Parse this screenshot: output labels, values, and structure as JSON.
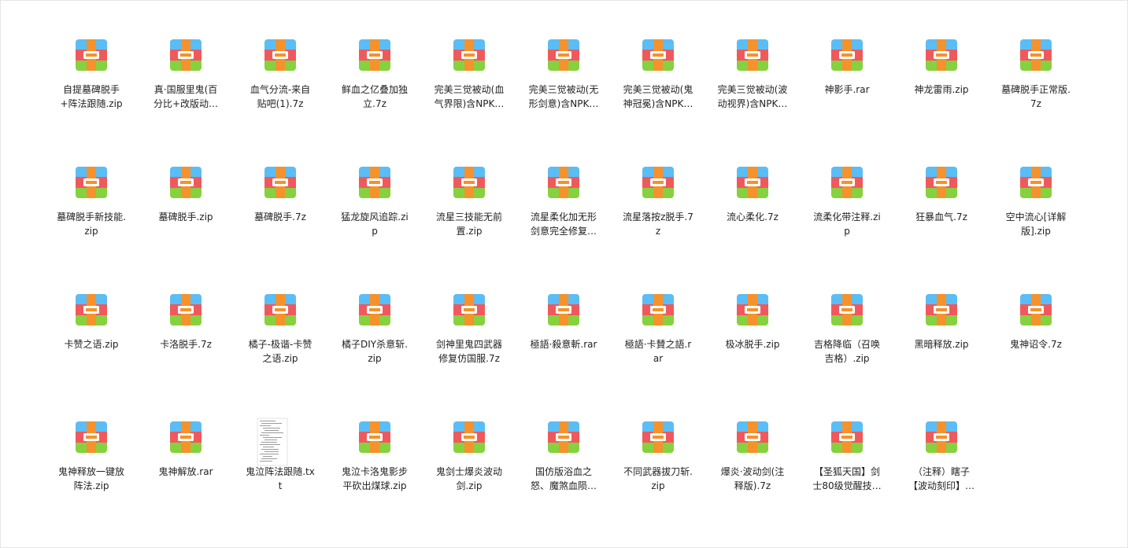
{
  "files": [
    {
      "kind": "archive",
      "lines": [
        "自提墓碑脱手",
        "+阵法跟随.zip"
      ]
    },
    {
      "kind": "archive",
      "lines": [
        "真·国服里鬼(百",
        "分比+改版动…"
      ]
    },
    {
      "kind": "archive",
      "lines": [
        "血气分流-来自",
        "贴吧(1).7z"
      ]
    },
    {
      "kind": "archive",
      "lines": [
        "鲜血之亿叠加独",
        "立.7z"
      ]
    },
    {
      "kind": "archive",
      "lines": [
        "完美三觉被动(血",
        "气界限)含NPK…"
      ]
    },
    {
      "kind": "archive",
      "lines": [
        "完美三觉被动(无",
        "形剑意)含NPK…"
      ]
    },
    {
      "kind": "archive",
      "lines": [
        "完美三觉被动(鬼",
        "神冠冕)含NPK…"
      ]
    },
    {
      "kind": "archive",
      "lines": [
        "完美三觉被动(波",
        "动视界)含NPK…"
      ]
    },
    {
      "kind": "archive",
      "lines": [
        "神影手.rar"
      ]
    },
    {
      "kind": "archive",
      "lines": [
        "神龙雷雨.zip"
      ]
    },
    {
      "kind": "archive",
      "lines": [
        "墓碑脱手正常版.",
        "7z"
      ]
    },
    {
      "kind": "archive",
      "lines": [
        "墓碑脱手新技能.",
        "zip"
      ]
    },
    {
      "kind": "archive",
      "lines": [
        "墓碑脱手.zip"
      ]
    },
    {
      "kind": "archive",
      "lines": [
        "墓碑脱手.7z"
      ]
    },
    {
      "kind": "archive",
      "lines": [
        "猛龙旋风追踪.zi",
        "p"
      ]
    },
    {
      "kind": "archive",
      "lines": [
        "流星三技能无前",
        "置.zip"
      ]
    },
    {
      "kind": "archive",
      "lines": [
        "流星柔化加无形",
        "剑意完全修复…"
      ]
    },
    {
      "kind": "archive",
      "lines": [
        "流星落按z脱手.7",
        "z"
      ]
    },
    {
      "kind": "archive",
      "lines": [
        "流心柔化.7z"
      ]
    },
    {
      "kind": "archive",
      "lines": [
        "流柔化带注释.zi",
        "p"
      ]
    },
    {
      "kind": "archive",
      "lines": [
        "狂暴血气.7z"
      ]
    },
    {
      "kind": "archive",
      "lines": [
        "空中流心[详解",
        "版].zip"
      ]
    },
    {
      "kind": "archive",
      "lines": [
        "卡赞之语.zip"
      ]
    },
    {
      "kind": "archive",
      "lines": [
        "卡洛脱手.7z"
      ]
    },
    {
      "kind": "archive",
      "lines": [
        "橘子-极谐-卡赞",
        "之语.zip"
      ]
    },
    {
      "kind": "archive",
      "lines": [
        "橘子DIY杀意斩.",
        "zip"
      ]
    },
    {
      "kind": "archive",
      "lines": [
        "剑神里鬼四武器",
        "修复仿国服.7z"
      ]
    },
    {
      "kind": "archive",
      "lines": [
        "極語·殺意斬.rar"
      ]
    },
    {
      "kind": "archive",
      "lines": [
        "極語·卡賛之語.r",
        "ar"
      ]
    },
    {
      "kind": "archive",
      "lines": [
        "极冰脱手.zip"
      ]
    },
    {
      "kind": "archive",
      "lines": [
        "吉格降临（召唤",
        "吉格）.zip"
      ]
    },
    {
      "kind": "archive",
      "lines": [
        "黑暗释放.zip"
      ]
    },
    {
      "kind": "archive",
      "lines": [
        "鬼神诏令.7z"
      ]
    },
    {
      "kind": "archive",
      "lines": [
        "鬼神释放一键放",
        "阵法.zip"
      ]
    },
    {
      "kind": "archive",
      "lines": [
        "鬼神解放.rar"
      ]
    },
    {
      "kind": "text",
      "lines": [
        "鬼泣阵法跟随.tx",
        "t"
      ]
    },
    {
      "kind": "archive",
      "lines": [
        "鬼泣卡洛鬼影步",
        "平砍出煤球.zip"
      ]
    },
    {
      "kind": "archive",
      "lines": [
        "鬼剑士爆炎波动",
        "剑.zip"
      ]
    },
    {
      "kind": "archive",
      "lines": [
        "国仿版浴血之",
        "怒、魔煞血陨…"
      ]
    },
    {
      "kind": "archive",
      "lines": [
        "不同武器拔刀斩.",
        "zip"
      ]
    },
    {
      "kind": "archive",
      "lines": [
        "爆炎·波动剑(注",
        "释版).7z"
      ]
    },
    {
      "kind": "archive",
      "lines": [
        "【圣狐天国】剑",
        "士80级觉醒技…"
      ]
    },
    {
      "kind": "archive",
      "lines": [
        "（注释）瞎子",
        "【波动刻印】…"
      ]
    }
  ],
  "colors": {
    "archive_top": "#5bbdf5",
    "archive_mid": "#f0595c",
    "archive_bottom": "#86d13f",
    "archive_strap": "#f5922b"
  }
}
